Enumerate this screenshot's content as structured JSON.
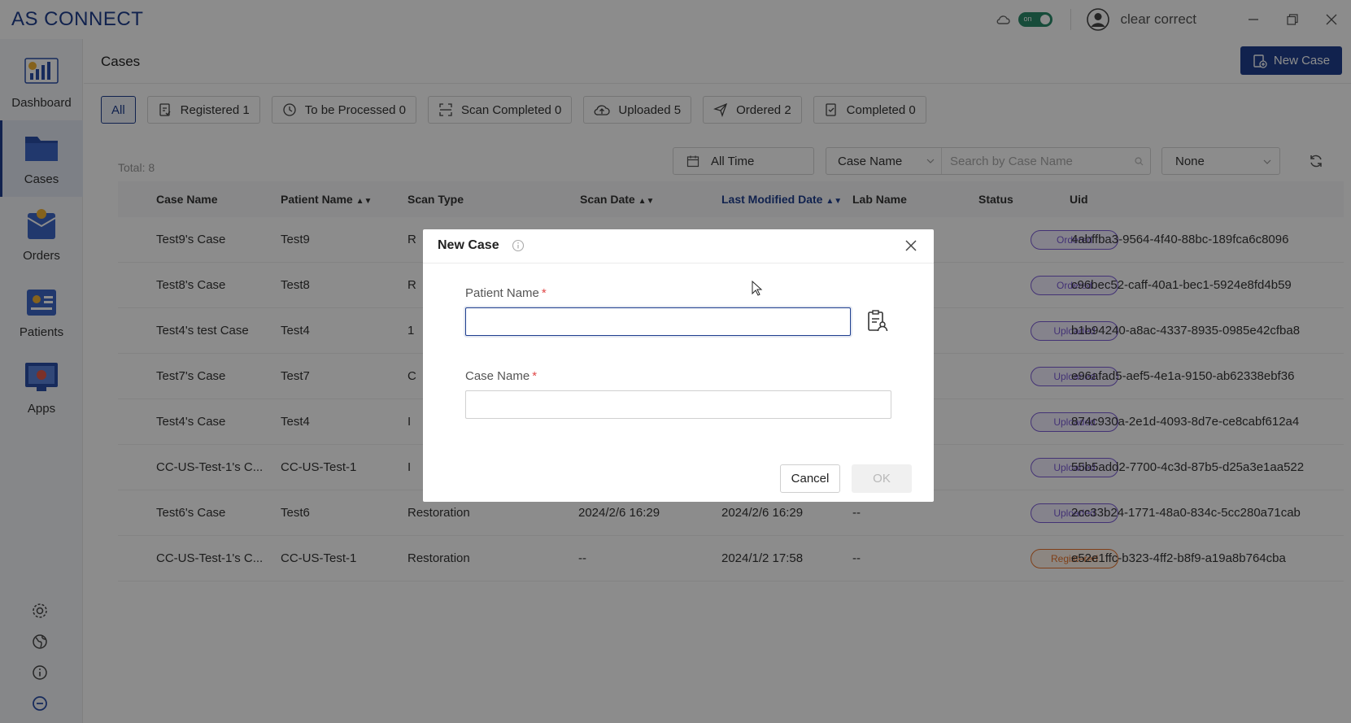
{
  "app": {
    "logo": "AS CONNECT",
    "user_name": "clear correct",
    "toggle_label": "on"
  },
  "sidebar": {
    "items": [
      {
        "label": "Dashboard",
        "icon": "dashboard-icon"
      },
      {
        "label": "Cases",
        "icon": "cases-folder-icon",
        "active": true
      },
      {
        "label": "Orders",
        "icon": "orders-icon"
      },
      {
        "label": "Patients",
        "icon": "patients-icon"
      },
      {
        "label": "Apps",
        "icon": "apps-monitor-icon"
      }
    ],
    "tools": [
      "settings-icon",
      "globe-icon",
      "info-icon",
      "minus-circle-icon"
    ]
  },
  "header": {
    "title": "Cases",
    "new_case_label": "New Case"
  },
  "filters": [
    {
      "label": "All",
      "active": true
    },
    {
      "label": "Registered 1"
    },
    {
      "label": "To be Processed 0"
    },
    {
      "label": "Scan Completed 0"
    },
    {
      "label": "Uploaded 5"
    },
    {
      "label": "Ordered 2"
    },
    {
      "label": "Completed 0"
    }
  ],
  "toolbar": {
    "total": "Total: 8",
    "time_filter": "All Time",
    "search_field": "Case Name",
    "search_placeholder": "Search by Case Name",
    "lab_filter": "None"
  },
  "table": {
    "columns": [
      "Case Name",
      "Patient Name",
      "Scan Type",
      "Scan Date",
      "Last Modified Date",
      "Lab Name",
      "Status",
      "Uid"
    ],
    "rows": [
      {
        "case": "Test9's Case",
        "patient": "Test9",
        "scan_type": "R",
        "scan_date": "",
        "modified": "",
        "lab": "",
        "status": "Ordered",
        "uid": "4abffba3-9564-4f40-88bc-189fca6c8096"
      },
      {
        "case": "Test8's Case",
        "patient": "Test8",
        "scan_type": "R",
        "scan_date": "",
        "modified": "",
        "lab": "",
        "status": "Ordered",
        "uid": "c96bec52-caff-40a1-bec1-5924e8fd4b59"
      },
      {
        "case": "Test4's test Case",
        "patient": "Test4",
        "scan_type": "1",
        "scan_date": "",
        "modified": "",
        "lab": "",
        "status": "Uploaded",
        "uid": "b1b94240-a8ac-4337-8935-0985e42cfba8"
      },
      {
        "case": "Test7's Case",
        "patient": "Test7",
        "scan_type": "C",
        "scan_date": "",
        "modified": "",
        "lab": "",
        "status": "Uploaded",
        "uid": "e96afad5-aef5-4e1a-9150-ab62338ebf36"
      },
      {
        "case": "Test4's Case",
        "patient": "Test4",
        "scan_type": "I",
        "scan_date": "",
        "modified": "",
        "lab": "",
        "status": "Uploaded",
        "uid": "874c930a-2e1d-4093-8d7e-ce8cabf612a4"
      },
      {
        "case": "CC-US-Test-1's C...",
        "patient": "CC-US-Test-1",
        "scan_type": "I",
        "scan_date": "",
        "modified": "",
        "lab": "",
        "status": "Uploaded",
        "uid": "55b5add2-7700-4c3d-87b5-d25a3e1aa522"
      },
      {
        "case": "Test6's Case",
        "patient": "Test6",
        "scan_type": "Restoration",
        "scan_date": "2024/2/6 16:29",
        "modified": "2024/2/6 16:29",
        "lab": "--",
        "status": "Uploaded",
        "uid": "2cc33b24-1771-48a0-834c-5cc280a71cab"
      },
      {
        "case": "CC-US-Test-1's C...",
        "patient": "CC-US-Test-1",
        "scan_type": "Restoration",
        "scan_date": "--",
        "modified": "2024/1/2 17:58",
        "lab": "--",
        "status": "Registered",
        "uid": "e52e1ffc-b323-4ff2-b8f9-a19a8b764cba"
      }
    ]
  },
  "modal": {
    "title": "New Case",
    "patient_label": "Patient Name",
    "case_label": "Case Name",
    "required_mark": "*",
    "patient_value": "",
    "case_value": "",
    "cancel_label": "Cancel",
    "ok_label": "OK"
  },
  "colors": {
    "brand": "#1f3f8f",
    "ordered": "#7a5bd6",
    "registered": "#e8742d"
  }
}
